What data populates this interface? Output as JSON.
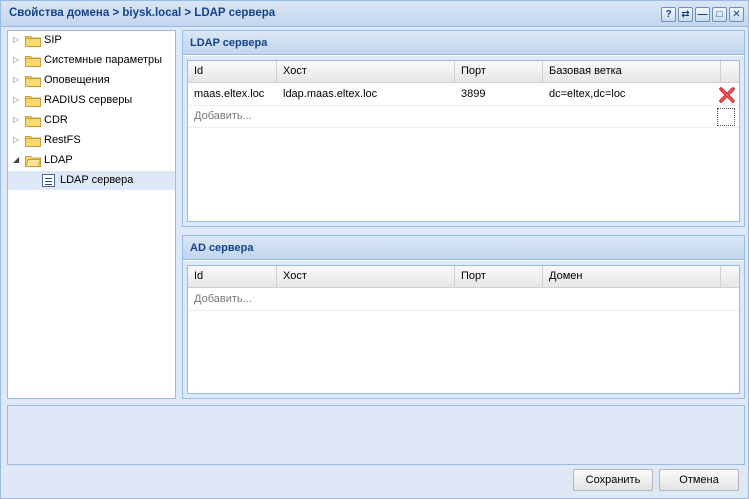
{
  "window": {
    "title": "Свойства домена > biysk.local > LDAP сервера",
    "tools": [
      "?",
      "⇄",
      "—",
      "□",
      "✕"
    ]
  },
  "tree": {
    "items": [
      {
        "label": "SIP",
        "expanded": false
      },
      {
        "label": "Системные параметры",
        "expanded": false
      },
      {
        "label": "Оповещения",
        "expanded": false
      },
      {
        "label": "RADIUS серверы",
        "expanded": false
      },
      {
        "label": "CDR",
        "expanded": false
      },
      {
        "label": "RestFS",
        "expanded": false
      },
      {
        "label": "LDAP",
        "expanded": true
      },
      {
        "label": "LDAP сервера",
        "selected": true
      }
    ]
  },
  "ldap_panel": {
    "title": "LDAP сервера",
    "columns": [
      "Id",
      "Хост",
      "Порт",
      "Базовая ветка"
    ],
    "rows": [
      {
        "id": "maas.eltex.loc",
        "host": "ldap.maas.eltex.loc",
        "port": "3899",
        "base": "dc=eltex,dc=loc"
      }
    ],
    "add_label": "Добавить..."
  },
  "ad_panel": {
    "title": "AD сервера",
    "columns": [
      "Id",
      "Хост",
      "Порт",
      "Домен"
    ],
    "add_label": "Добавить..."
  },
  "buttons": {
    "save": "Сохранить",
    "cancel": "Отмена"
  },
  "colors": {
    "title_text": "#15428b",
    "border": "#99bbe8",
    "background": "#dfe8f6",
    "delete_icon": "#d9252b"
  }
}
